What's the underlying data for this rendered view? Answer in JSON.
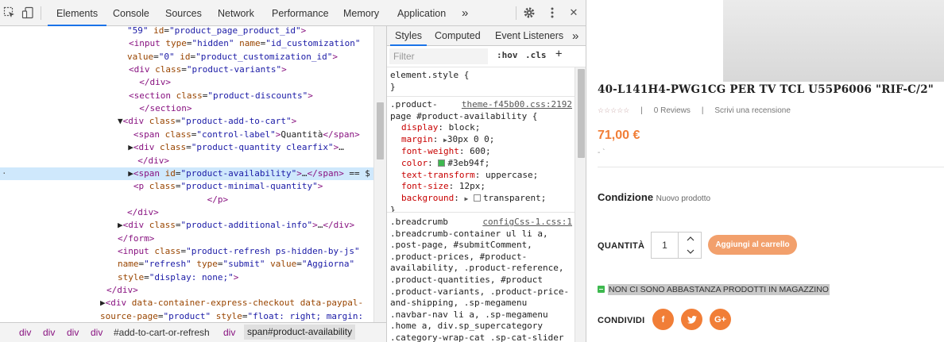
{
  "devtools": {
    "tabs": [
      "Elements",
      "Console",
      "Sources",
      "Network",
      "Performance",
      "Memory",
      "Application"
    ],
    "more": "»",
    "close": "✕",
    "tree": [
      {
        "html": "<span class=\"val\">\"59\"</span> <span class=\"attr\">id</span>=<span class=\"val\">\"product_page_product_id\"</span><span class=\"tag\">&gt;</span>"
      },
      {
        "html": "<span class=\"tag\">&lt;input</span> <span class=\"attr\">type</span>=<span class=\"val\">\"hidden\"</span> <span class=\"attr\">name</span>=<span class=\"val\">\"id_customization\"</span>"
      },
      {
        "html": "<span class=\"attr\">value</span>=<span class=\"val\">\"0\"</span> <span class=\"attr\">id</span>=<span class=\"val\">\"product_customization_id\"</span><span class=\"tag\">&gt;</span>"
      },
      {
        "html": "<span class=\"tag\">&lt;div</span> <span class=\"attr\">class</span>=<span class=\"val\">\"product-variants\"</span><span class=\"tag\">&gt;</span>"
      },
      {
        "html": "  <span class=\"tag\">&lt;/div&gt;</span>"
      },
      {
        "html": "<span class=\"tag\">&lt;section</span> <span class=\"attr\">class</span>=<span class=\"val\">\"product-discounts\"</span><span class=\"tag\">&gt;</span>"
      },
      {
        "html": "  <span class=\"tag\">&lt;/section&gt;</span>"
      },
      {
        "html": "▼<span class=\"tag\">&lt;div</span> <span class=\"attr\">class</span>=<span class=\"val\">\"product-add-to-cart\"</span><span class=\"tag\">&gt;</span>"
      },
      {
        "html": "   <span class=\"tag\">&lt;span</span> <span class=\"attr\">class</span>=<span class=\"val\">\"control-label\"</span><span class=\"tag\">&gt;</span>Quantità<span class=\"tag\">&lt;/span&gt;</span>"
      },
      {
        "html": "  ▶<span class=\"tag\">&lt;div</span> <span class=\"attr\">class</span>=<span class=\"val\">\"product-quantity clearfix\"</span><span class=\"tag\">&gt;</span>…"
      },
      {
        "html": "  <span class=\"tag\">&lt;/div&gt;</span>"
      },
      {
        "html": "  ▶<span class=\"tag\">&lt;span</span> <span class=\"attr\">id</span>=<span class=\"val\">\"product-availability\"</span><span class=\"tag\">&gt;</span>…<span class=\"tag\">&lt;/span&gt;</span> == $"
      },
      {
        "html": "   <span class=\"tag\">&lt;p</span> <span class=\"attr\">class</span>=<span class=\"val\">\"product-minimal-quantity\"</span><span class=\"tag\">&gt;</span>"
      },
      {
        "html": "                 <span class=\"tag\">&lt;/p&gt;</span>"
      },
      {
        "html": "<span class=\"tag\">&lt;/div&gt;</span>"
      },
      {
        "html": "▶<span class=\"tag\">&lt;div</span> <span class=\"attr\">class</span>=<span class=\"val\">\"product-additional-info\"</span><span class=\"tag\">&gt;</span>…<span class=\"tag\">&lt;/div&gt;</span>"
      },
      {
        "html": "<span class=\"tag\">&lt;/form&gt;</span>"
      },
      {
        "html": "<span class=\"tag\">&lt;input</span> <span class=\"attr\">class</span>=<span class=\"val\">\"product-refresh ps-hidden-by-js\"</span>"
      },
      {
        "html": "<span class=\"attr\">name</span>=<span class=\"val\">\"refresh\"</span> <span class=\"attr\">type</span>=<span class=\"val\">\"submit\"</span> <span class=\"attr\">value</span>=<span class=\"val\">\"Aggiorna\"</span>"
      },
      {
        "html": "<span class=\"attr\">style</span>=<span class=\"val\">\"display: none;\"</span><span class=\"tag\">&gt;</span>"
      },
      {
        "html": "<span class=\"tag\">&lt;/div&gt;</span>"
      },
      {
        "html": "▶<span class=\"tag\">&lt;div</span> <span class=\"attr\">data-container-express-checkout</span> <span class=\"attr\">data-paypal-</span>"
      },
      {
        "html": "<span class=\"attr\">source-page</span>=<span class=\"val\">\"product\"</span> <span class=\"attr\">style</span>=<span class=\"val\">\"float: right; margin:</span>"
      }
    ],
    "breadcrumbs": [
      "div",
      "div",
      "div",
      "div",
      "#add-to-cart-or-refresh",
      "div",
      "span#product-availability"
    ],
    "styles_tabs": [
      "Styles",
      "Computed",
      "Event Listeners"
    ],
    "filter_placeholder": "Filter",
    "hov": ":hov",
    "cls": ".cls",
    "plus": "+",
    "element_style": "element.style {",
    "close_brace": "}",
    "rule1": {
      "selector_l1": ".product-",
      "selector_l2": "page #product-availability {",
      "source": "theme-f45b00.css:2192",
      "props": [
        {
          "name": "display",
          "value": "block;"
        },
        {
          "name": "margin",
          "value": "30px 0 0;"
        },
        {
          "name": "font-weight",
          "value": "600;"
        },
        {
          "name": "color",
          "value": "#3eb94f;"
        },
        {
          "name": "text-transform",
          "value": "uppercase;"
        },
        {
          "name": "font-size",
          "value": "12px;"
        },
        {
          "name": "background",
          "value": "transparent;"
        }
      ]
    },
    "rule2": {
      "source": "configCss-1.css:1",
      "lines": [
        ".breadcrumb",
        ".breadcrumb-container ul li a,",
        ".post-page, #submitComment,",
        ".product-prices, #product-",
        "availability, .product-reference,",
        ".product-quantities, #product",
        ".product-variants, .product-price-",
        "and-shipping, .sp-megamenu",
        ".navbar-nav li a, .sp-megamenu",
        ".home a, div.sp_supercategory",
        ".category-wrap-cat .sp-cat-slider"
      ]
    },
    "colors": {
      "swatch": "#3eb94f"
    }
  },
  "page": {
    "title": "40-L141H4-PWG1CG PER TV TCL U55P6006 \"RIF-C/2\"",
    "stars": "☆☆☆☆☆",
    "sep": "|",
    "reviews": "0 Reviews",
    "write_review": "Scrivi una recensione",
    "price": "71,00 €",
    "price_note": "- `",
    "condition_label": "Condizione",
    "condition_value": "Nuovo prodotto",
    "qty_label": "QUANTITÀ",
    "qty_value": "1",
    "add_to_cart": "Aggiungi al carrello",
    "availability": "NON CI SONO ABBASTANZA PRODOTTI IN MAGAZZINO",
    "share_label": "CONDIVIDI",
    "social": [
      "f",
      "t",
      "G+"
    ],
    "colors": {
      "accent": "#f17e37",
      "button": "#f2a06c",
      "available": "#3eb94f"
    }
  }
}
